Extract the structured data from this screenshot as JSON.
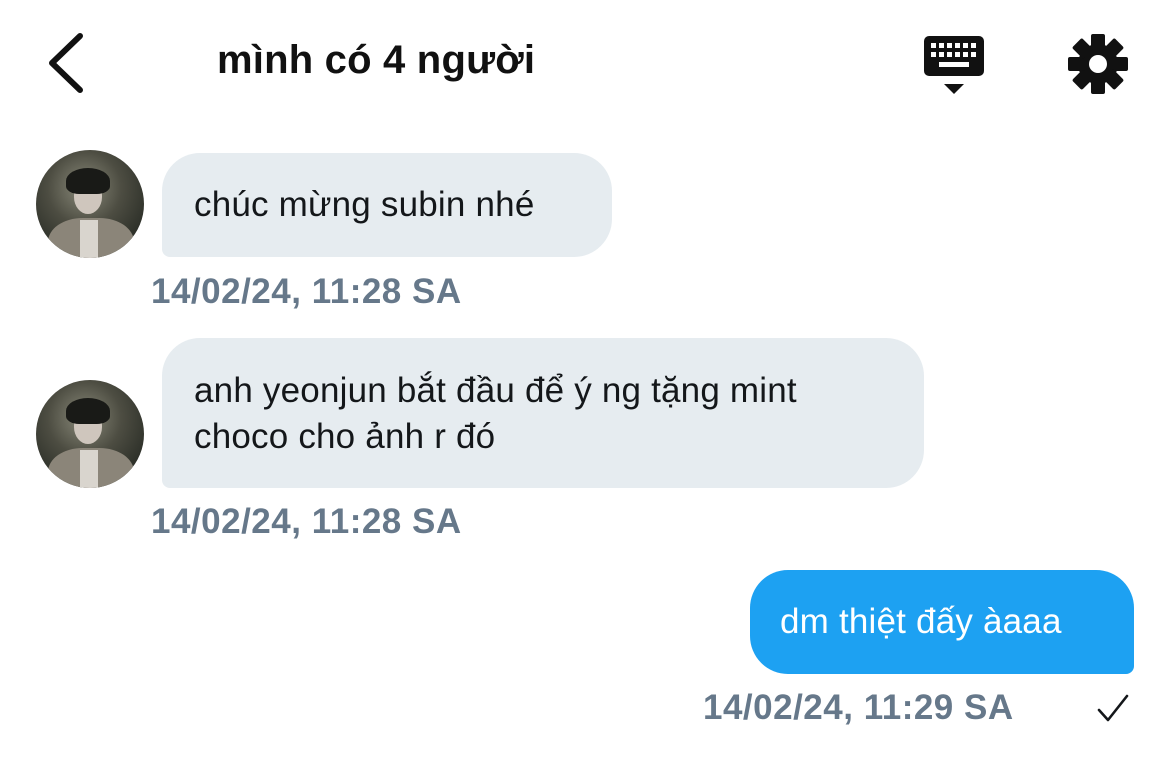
{
  "header": {
    "title": "mình có 4 người",
    "back_icon": "chevron-left-icon",
    "keyboard_icon": "keyboard-icon",
    "settings_icon": "gear-icon"
  },
  "messages": [
    {
      "sender": "other",
      "lines": [
        "chúc mừng subin nhé"
      ],
      "timestamp": "14/02/24, 11:28 SA"
    },
    {
      "sender": "other",
      "lines": [
        "anh yeonjun bắt đầu để ý ng tặng mint",
        "choco cho ảnh r đó"
      ],
      "timestamp": "14/02/24, 11:28 SA"
    },
    {
      "sender": "me",
      "lines": [
        "dm thiệt đấy àaaa"
      ],
      "timestamp": "14/02/24, 11:29 SA",
      "status_icon": "checkmark-icon"
    }
  ],
  "colors": {
    "incoming_bubble": "#e6ecf0",
    "outgoing_bubble": "#1da1f2",
    "timestamp": "#66788a"
  }
}
